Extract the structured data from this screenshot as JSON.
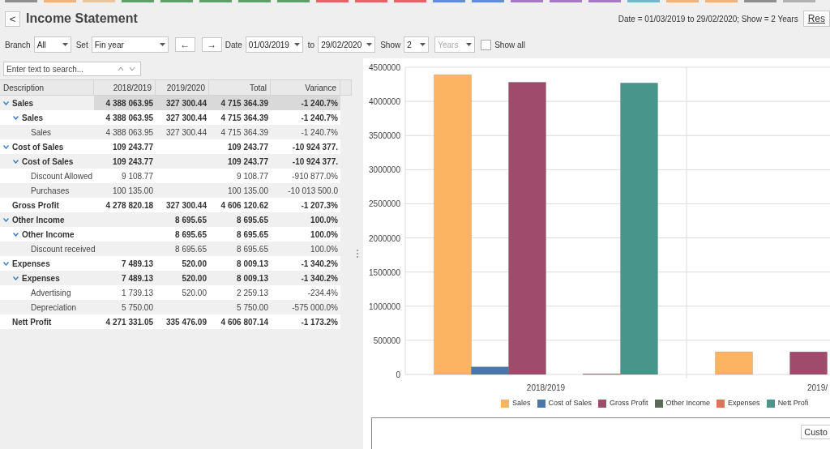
{
  "tab_strip": [
    {
      "color": "#8f8f8f"
    },
    {
      "color": "#f0b27a"
    },
    {
      "color": "#f0c49a"
    },
    {
      "color": "#5aa469"
    },
    {
      "color": "#5aa469"
    },
    {
      "color": "#5aa469"
    },
    {
      "color": "#5aa469"
    },
    {
      "color": "#5aa469"
    },
    {
      "color": "#e06666"
    },
    {
      "color": "#e06666"
    },
    {
      "color": "#e06666"
    },
    {
      "color": "#5b8fd6"
    },
    {
      "color": "#5b8fd6"
    },
    {
      "color": "#a678c9"
    },
    {
      "color": "#a678c9"
    },
    {
      "color": "#a678c9"
    },
    {
      "color": "#6fb7c9"
    },
    {
      "color": "#f0b27a"
    },
    {
      "color": "#f0b27a"
    },
    {
      "color": "#8f8f8f"
    },
    {
      "color": "#b0b0b0"
    }
  ],
  "header": {
    "back": "<",
    "title": "Income Statement",
    "summary": "Date = 01/03/2019 to 29/02/2020; Show = 2 Years",
    "reset_button": "Res"
  },
  "toolbar": {
    "branch_label": "Branch",
    "branch": "All",
    "set_label": "Set",
    "set": "Fin year",
    "prev": "←",
    "next": "→",
    "date_label": "Date",
    "date_from": "01/03/2019",
    "to_label": "to",
    "date_to": "29/02/2020",
    "show_label": "Show",
    "show": "2",
    "unit": {
      "value": "Years",
      "disabled": true
    },
    "show_all": {
      "label": "Show all",
      "checked": false
    }
  },
  "search": {
    "placeholder": "Enter text to search..."
  },
  "table": {
    "columns": [
      "Description",
      "2018/2019",
      "2019/2020",
      "Total",
      "Variance"
    ],
    "rows": [
      {
        "selected": true,
        "expanded": true,
        "cells": [
          "Sales",
          "4 388 063.95",
          "327 300.44",
          "4 715 364.39",
          "-1 240.7%"
        ],
        "children": [
          {
            "selected": false,
            "expanded": true,
            "cells": [
              "Sales",
              "4 388 063.95",
              "327 300.44",
              "4 715 364.39",
              "-1 240.7%"
            ],
            "children": [
              {
                "selected": false,
                "cells": [
                  "Sales",
                  "4 388 063.95",
                  "327 300.44",
                  "4 715 364.39",
                  "-1 240.7%"
                ]
              }
            ]
          }
        ]
      },
      {
        "selected": false,
        "expanded": true,
        "cells": [
          "Cost of Sales",
          "109 243.77",
          "",
          "109 243.77",
          "-10 924 377."
        ],
        "children": [
          {
            "selected": false,
            "expanded": true,
            "cells": [
              "Cost of Sales",
              "109 243.77",
              "",
              "109 243.77",
              "-10 924 377."
            ],
            "children": [
              {
                "selected": false,
                "cells": [
                  "Discount Allowed",
                  "9 108.77",
                  "",
                  "9 108.77",
                  "-910 877.0%"
                ]
              },
              {
                "selected": false,
                "cells": [
                  "Purchases",
                  "100 135.00",
                  "",
                  "100 135.00",
                  "-10 013 500.0"
                ]
              }
            ]
          }
        ]
      },
      {
        "selected": false,
        "cells": [
          "Gross Profit",
          "4 278 820.18",
          "327 300.44",
          "4 606 120.62",
          "-1 207.3%"
        ]
      },
      {
        "selected": false,
        "expanded": true,
        "cells": [
          "Other Income",
          "",
          "8 695.65",
          "8 695.65",
          "100.0%"
        ],
        "children": [
          {
            "selected": false,
            "expanded": true,
            "cells": [
              "Other Income",
              "",
              "8 695.65",
              "8 695.65",
              "100.0%"
            ],
            "children": [
              {
                "selected": false,
                "cells": [
                  "Discount received",
                  "",
                  "8 695.65",
                  "8 695.65",
                  "100.0%"
                ]
              }
            ]
          }
        ]
      },
      {
        "selected": false,
        "expanded": true,
        "cells": [
          "Expenses",
          "7 489.13",
          "520.00",
          "8 009.13",
          "-1 340.2%"
        ],
        "children": [
          {
            "selected": false,
            "expanded": true,
            "cells": [
              "Expenses",
              "7 489.13",
              "520.00",
              "8 009.13",
              "-1 340.2%"
            ],
            "children": [
              {
                "selected": false,
                "cells": [
                  "Advertising",
                  "1 739.13",
                  "520.00",
                  "2 259.13",
                  "-234.4%"
                ]
              },
              {
                "selected": false,
                "cells": [
                  "Depreciation",
                  "5 750.00",
                  "",
                  "5 750.00",
                  "-575 000.0%"
                ]
              }
            ]
          }
        ]
      },
      {
        "selected": false,
        "cells": [
          "Nett Profit",
          "4 271 331.05",
          "335 476.09",
          "4 606 807.14",
          "-1 173.2%"
        ]
      }
    ]
  },
  "chart": {
    "chart_data": {
      "type": "bar",
      "grid": true,
      "categories": [
        "2018/2019",
        "2019/"
      ],
      "ylim": [
        0,
        4500000
      ],
      "yticks": [
        0,
        500000,
        1000000,
        1500000,
        2000000,
        2500000,
        3000000,
        3500000,
        4000000,
        4500000
      ],
      "series": [
        {
          "name": "Sales",
          "color": "#fdb462",
          "values": [
            4390000,
            330000
          ]
        },
        {
          "name": "Cost of Sales",
          "color": "#4a76a8",
          "values": [
            110000,
            null
          ]
        },
        {
          "name": "Gross Profit",
          "color": "#9e4b6c",
          "values": [
            4280000,
            330000
          ]
        },
        {
          "name": "Other Income",
          "color": "#5a6b57",
          "values": [
            null,
            null
          ]
        },
        {
          "name": "Expenses",
          "color": "#e0725a",
          "values": [
            10000,
            null
          ]
        },
        {
          "name": "Nett Profi",
          "color": "#48958c",
          "values": [
            4270000,
            null
          ]
        }
      ]
    }
  },
  "lower_panel": {
    "button": "Custo"
  }
}
